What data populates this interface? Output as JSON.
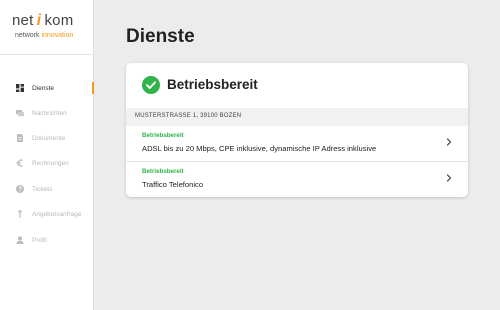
{
  "logo": {
    "part1": "net",
    "part2": "kom",
    "sub_main": "network",
    "sub_accent": "innovation"
  },
  "nav": [
    {
      "label": "Dienste",
      "icon": "dashboard-icon",
      "active": true
    },
    {
      "label": "Nachrichten",
      "icon": "message-icon",
      "active": false
    },
    {
      "label": "Dokumente",
      "icon": "document-icon",
      "active": false
    },
    {
      "label": "Rechnungen",
      "icon": "euro-icon",
      "active": false
    },
    {
      "label": "Tickets",
      "icon": "help-icon",
      "active": false
    },
    {
      "label": "Angebotsanfrage",
      "icon": "tool-icon",
      "active": false
    },
    {
      "label": "Profil",
      "icon": "user-icon",
      "active": false
    }
  ],
  "page": {
    "title": "Dienste"
  },
  "card": {
    "status": "Betriebsbereit",
    "address": "MUSTERSTRASSE 1, 39100 BOZEN",
    "services": [
      {
        "status": "Betriebsbereit",
        "description": "ADSL bis zu 20 Mbps, CPE inklusive, dynamische IP Adress inklusive"
      },
      {
        "status": "Betriebsbereit",
        "description": "Traffico Telefonico"
      }
    ]
  },
  "colors": {
    "accent": "#f39a1b",
    "ok": "#2fb34a",
    "sidebar_bg": "#ffffff",
    "page_bg": "#ececec"
  }
}
